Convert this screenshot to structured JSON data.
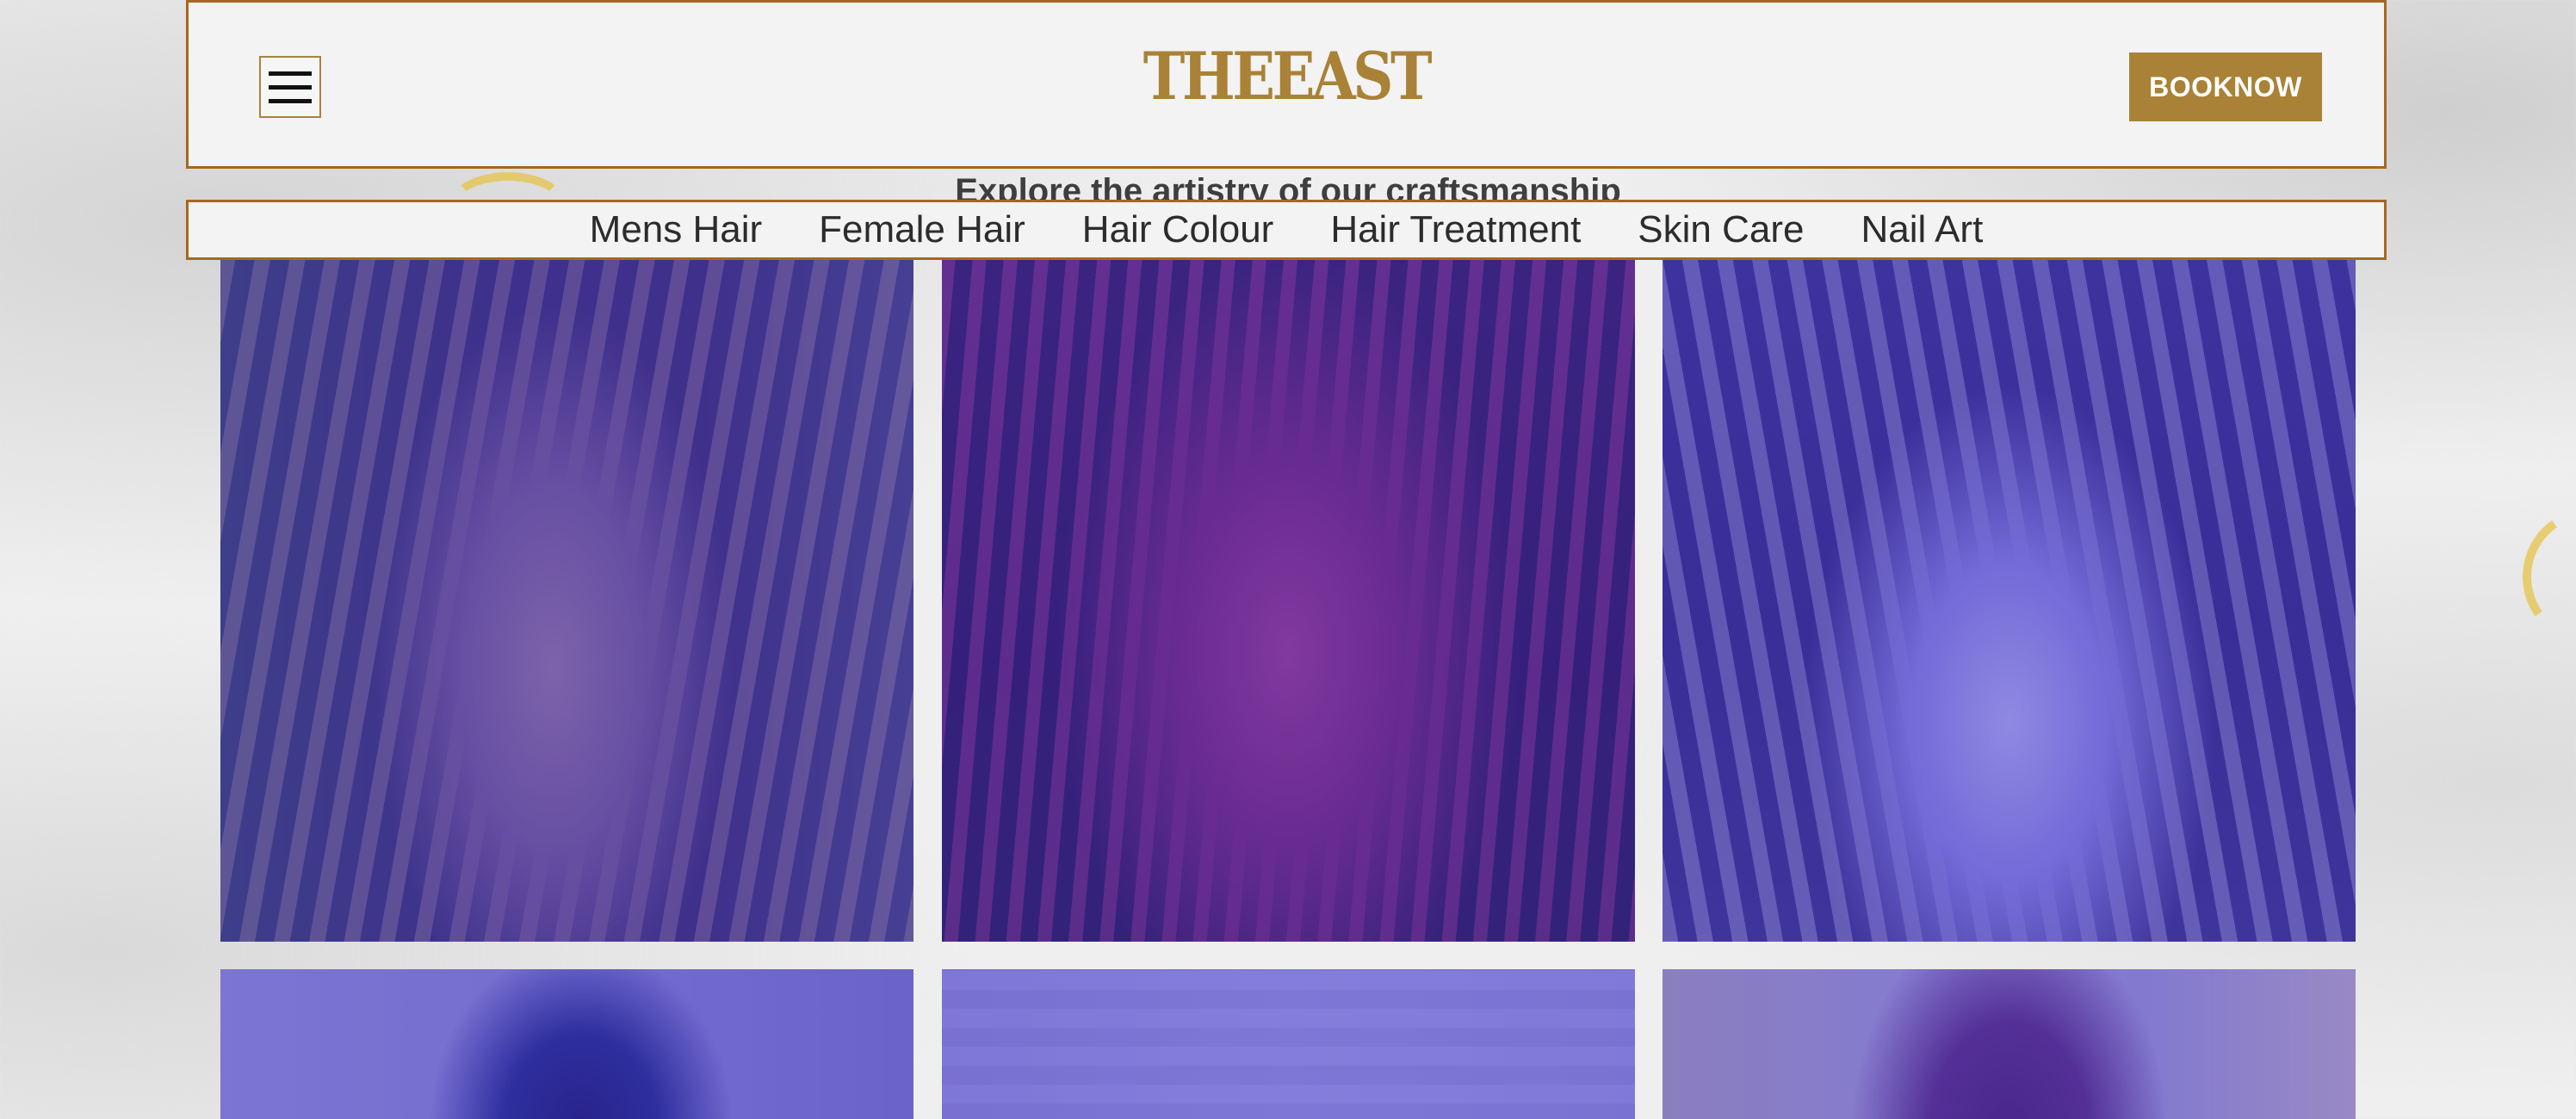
{
  "header": {
    "logo": "THEEAST",
    "book_label": "BOOKNOW"
  },
  "tagline": "Explore the artistry of our craftsmanship",
  "categories": [
    {
      "label": "Mens Hair"
    },
    {
      "label": "Female Hair"
    },
    {
      "label": "Hair Colour"
    },
    {
      "label": "Hair Treatment"
    },
    {
      "label": "Skin Care"
    },
    {
      "label": "Nail Art"
    }
  ],
  "gallery": {
    "item_count_visible": 6
  },
  "colors": {
    "accent_gold": "#a98237",
    "border_brown": "#a8671e",
    "overlay_purple": "#4637c8",
    "header_bg": "#f3f3f3"
  },
  "icons": {
    "menu": "hamburger-menu-icon"
  }
}
